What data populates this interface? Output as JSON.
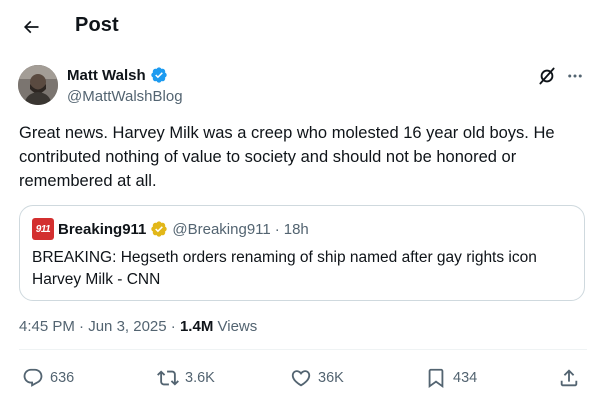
{
  "header": {
    "title": "Post",
    "back_icon": "arrow-left-icon"
  },
  "author": {
    "name": "Matt Walsh",
    "handle": "@MattWalshBlog",
    "verified_color": "#1d9bf0"
  },
  "post": {
    "text": "Great news. Harvey Milk was a creep who molested 16 year old boys. He contributed nothing of value to society and should not be honored or remembered at all."
  },
  "quote": {
    "logo_text": "911",
    "name": "Breaking911",
    "handle": "@Breaking911",
    "separator": "·",
    "time": "18h",
    "verified_color": "#e2b719",
    "text": "BREAKING: Hegseth orders renaming of ship named after gay rights icon Harvey Milk - CNN"
  },
  "meta": {
    "time": "4:45 PM",
    "separator": "·",
    "date": "Jun 3, 2025",
    "views_count": "1.4M",
    "views_label": "Views"
  },
  "actions": {
    "replies": "636",
    "reposts": "3.6K",
    "likes": "36K",
    "bookmarks": "434"
  },
  "colors": {
    "text": "#0f1419",
    "secondary": "#536471",
    "border": "#cfd9de"
  }
}
